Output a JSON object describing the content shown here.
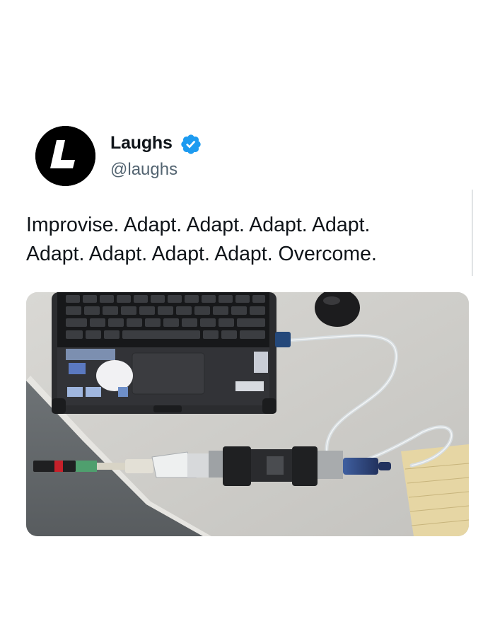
{
  "tweet": {
    "author": {
      "display_name": "Laughs",
      "handle": "@laughs",
      "avatar_letter": "L",
      "verified": true,
      "verified_color": "#1d9bf0"
    },
    "text_lines": [
      "Improvise. Adapt. Adapt. Adapt. Adapt.",
      "Adapt. Adapt. Adapt. Adapt. Overcome."
    ],
    "media": {
      "icon": "photo-of-laptop-with-chained-adapters"
    }
  },
  "colors": {
    "text": "#0f1419",
    "secondary_text": "#536471",
    "background": "#ffffff"
  }
}
